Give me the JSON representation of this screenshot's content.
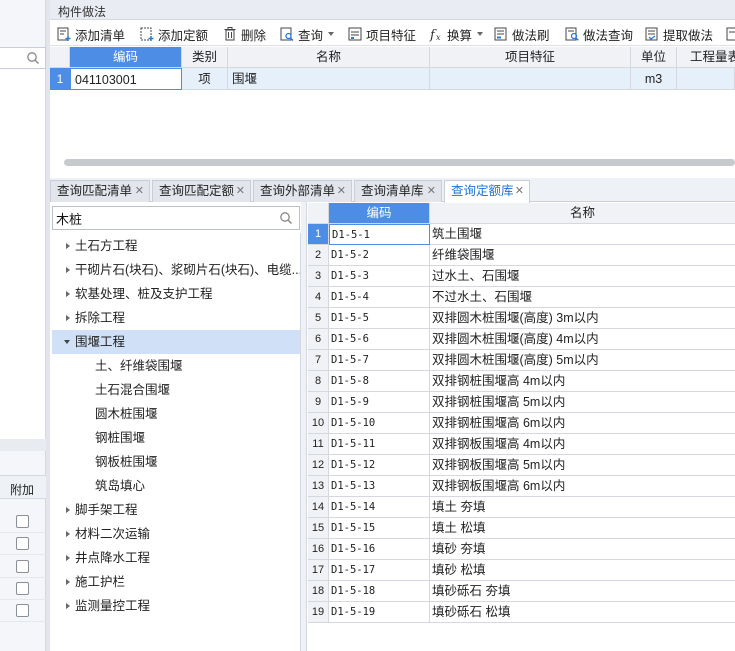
{
  "panel": {
    "title": "构件做法"
  },
  "toolbar": {
    "add_list": "添加清单",
    "add_quota": "添加定额",
    "delete": "删除",
    "query": "查询",
    "item_feature": "项目特征",
    "convert": "换算",
    "method_brush": "做法刷",
    "method_query": "做法查询",
    "extract_method": "提取做法"
  },
  "top_grid": {
    "headers": {
      "code": "编码",
      "category": "类别",
      "name": "名称",
      "feature": "项目特征",
      "unit": "单位",
      "quantity": "工程量表"
    },
    "rows": [
      {
        "num": "1",
        "code": "041103001",
        "category": "项",
        "name": "围堰",
        "feature": "",
        "unit": "m3",
        "quantity": ""
      }
    ]
  },
  "tabs": [
    {
      "label": "查询匹配清单"
    },
    {
      "label": "查询匹配定额"
    },
    {
      "label": "查询外部清单"
    },
    {
      "label": "查询清单库"
    },
    {
      "label": "查询定额库"
    }
  ],
  "search": {
    "value": "木桩"
  },
  "tree": {
    "items": [
      {
        "label": "土石方工程"
      },
      {
        "label": "干砌片石(块石)、浆砌片石(块石)、电缆..."
      },
      {
        "label": "软基处理、桩及支护工程"
      },
      {
        "label": "拆除工程"
      },
      {
        "label": "围堰工程"
      },
      {
        "label": "土、纤维袋围堰"
      },
      {
        "label": "土石混合围堰"
      },
      {
        "label": "圆木桩围堰"
      },
      {
        "label": "钢桩围堰"
      },
      {
        "label": "钢板桩围堰"
      },
      {
        "label": "筑岛填心"
      },
      {
        "label": "脚手架工程"
      },
      {
        "label": "材料二次运输"
      },
      {
        "label": "井点降水工程"
      },
      {
        "label": "施工护栏"
      },
      {
        "label": "监测量控工程"
      }
    ]
  },
  "quota_grid": {
    "headers": {
      "code": "编码",
      "name": "名称"
    },
    "rows": [
      {
        "num": "1",
        "code": "D1-5-1",
        "name": "筑土围堰"
      },
      {
        "num": "2",
        "code": "D1-5-2",
        "name": "纤维袋围堰"
      },
      {
        "num": "3",
        "code": "D1-5-3",
        "name": "过水土、石围堰"
      },
      {
        "num": "4",
        "code": "D1-5-4",
        "name": "不过水土、石围堰"
      },
      {
        "num": "5",
        "code": "D1-5-5",
        "name": "双排圆木桩围堰(高度) 3m以内"
      },
      {
        "num": "6",
        "code": "D1-5-6",
        "name": "双排圆木桩围堰(高度) 4m以内"
      },
      {
        "num": "7",
        "code": "D1-5-7",
        "name": "双排圆木桩围堰(高度) 5m以内"
      },
      {
        "num": "8",
        "code": "D1-5-8",
        "name": "双排钢桩围堰高 4m以内"
      },
      {
        "num": "9",
        "code": "D1-5-9",
        "name": "双排钢桩围堰高 5m以内"
      },
      {
        "num": "10",
        "code": "D1-5-10",
        "name": "双排钢桩围堰高 6m以内"
      },
      {
        "num": "11",
        "code": "D1-5-11",
        "name": "双排钢板围堰高 4m以内"
      },
      {
        "num": "12",
        "code": "D1-5-12",
        "name": "双排钢板围堰高 5m以内"
      },
      {
        "num": "13",
        "code": "D1-5-13",
        "name": "双排钢板围堰高 6m以内"
      },
      {
        "num": "14",
        "code": "D1-5-14",
        "name": "填土 夯填"
      },
      {
        "num": "15",
        "code": "D1-5-15",
        "name": "填土 松填"
      },
      {
        "num": "16",
        "code": "D1-5-16",
        "name": "填砂 夯填"
      },
      {
        "num": "17",
        "code": "D1-5-17",
        "name": "填砂 松填"
      },
      {
        "num": "18",
        "code": "D1-5-18",
        "name": "填砂砾石 夯填"
      },
      {
        "num": "19",
        "code": "D1-5-19",
        "name": "填砂砾石 松填"
      }
    ]
  },
  "left_table": {
    "header": "附加"
  },
  "colors": {
    "accent": "#4d8de6",
    "selected_row": "#e6f0fb",
    "tree_selected": "#cfe0f7",
    "active_tab_text": "#1f6fd6"
  }
}
